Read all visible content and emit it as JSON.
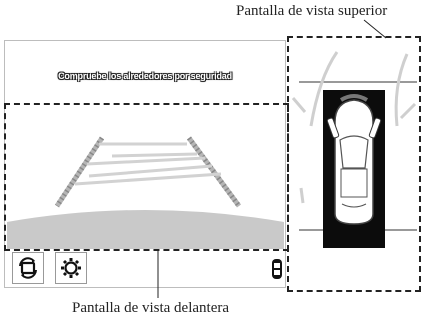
{
  "captions": {
    "top_view": "Pantalla de vista superior",
    "front_view": "Pantalla de vista delantera"
  },
  "screen": {
    "warning": "Compruebe los alrededores por seguridad"
  },
  "buttons": {
    "camera_switch_icon": "camera-switch-icon",
    "settings_icon": "gear-icon"
  }
}
